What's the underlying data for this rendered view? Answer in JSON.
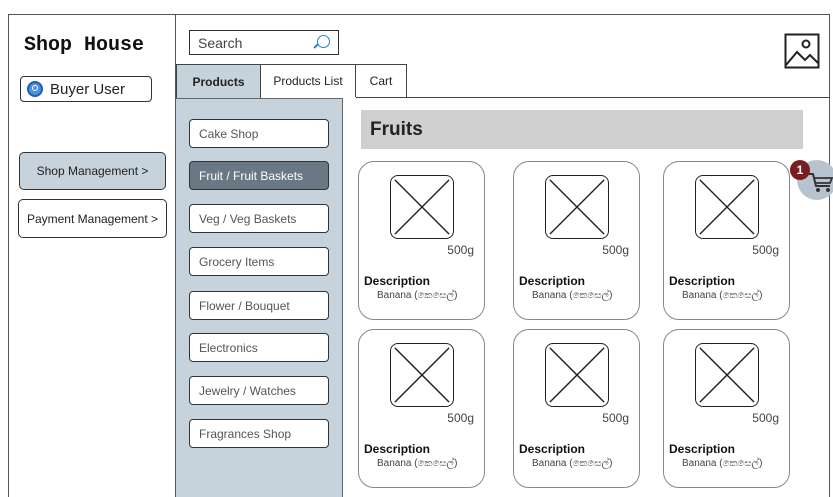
{
  "app": {
    "title": "Shop House"
  },
  "user": {
    "label": "Buyer User"
  },
  "sidebar": {
    "items": [
      {
        "label": "Shop Management >"
      },
      {
        "label": "Payment Management >"
      }
    ]
  },
  "search": {
    "value": "Search"
  },
  "tabs": [
    {
      "label": "Products",
      "active": true
    },
    {
      "label": "Products List",
      "active": false
    },
    {
      "label": "Cart",
      "active": false
    }
  ],
  "categories": [
    {
      "label": "Cake Shop",
      "active": false
    },
    {
      "label": "Fruit / Fruit Baskets",
      "active": true
    },
    {
      "label": "Veg / Veg Baskets",
      "active": false
    },
    {
      "label": "Grocery Items",
      "active": false
    },
    {
      "label": "Flower / Bouquet",
      "active": false
    },
    {
      "label": "Electronics",
      "active": false
    },
    {
      "label": "Jewelry / Watches",
      "active": false
    },
    {
      "label": "Fragrances Shop",
      "active": false
    }
  ],
  "section": {
    "title": "Fruits"
  },
  "products": [
    {
      "weight": "500g",
      "description": "Description",
      "name": "Banana (කෙසෙල්)"
    },
    {
      "weight": "500g",
      "description": "Description",
      "name": "Banana (කෙසෙල්)"
    },
    {
      "weight": "500g",
      "description": "Description",
      "name": "Banana (කෙසෙල්)"
    },
    {
      "weight": "500g",
      "description": "Description",
      "name": "Banana (කෙසෙල්)"
    },
    {
      "weight": "500g",
      "description": "Description",
      "name": "Banana (කෙසෙල්)"
    },
    {
      "weight": "500g",
      "description": "Description",
      "name": "Banana (කෙසෙල්)"
    }
  ],
  "cart": {
    "count": "1"
  },
  "icons": {
    "user": "user-circle-icon",
    "search": "search-icon",
    "image": "image-icon",
    "cart": "shopping-cart-icon",
    "placeholder": "image-placeholder-icon"
  },
  "colors": {
    "panel": "#c7d3dc",
    "active_category": "#6a7785",
    "badge": "#7a1d22",
    "section_header": "#cfcfcf",
    "search_icon": "#2a7fd4"
  }
}
